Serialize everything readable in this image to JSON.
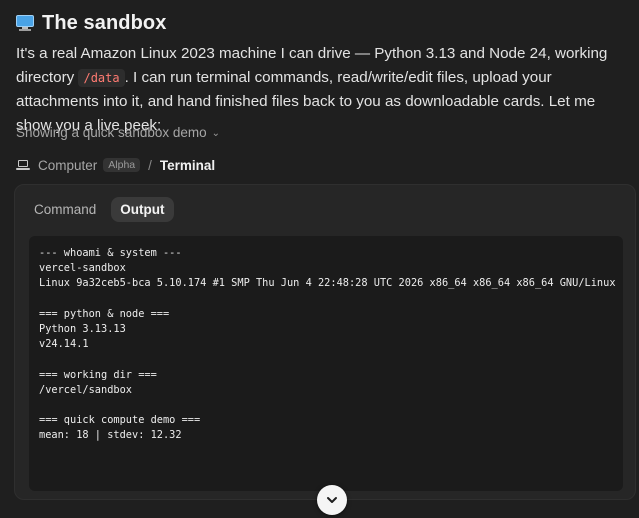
{
  "heading": {
    "icon": "desktop-computer-icon",
    "title": "The sandbox"
  },
  "intro": {
    "part1": "It's a real Amazon Linux 2023 machine I can drive — Python 3.13 and Node 24, working directory ",
    "code": "/data",
    "part2": ". I can run terminal commands, read/write/edit files, upload your attachments into it, and hand finished files back to you as downloadable cards. Let me show you a live peek:"
  },
  "demo_toggle": {
    "label": "Showing a quick sandbox demo",
    "icon": "chevron-down-icon"
  },
  "breadcrumb": {
    "icon": "laptop-icon",
    "root": "Computer",
    "badge": "Alpha",
    "separator": "/",
    "current": "Terminal"
  },
  "tabs": [
    {
      "label": "Command",
      "active": false
    },
    {
      "label": "Output",
      "active": true
    }
  ],
  "terminal_lines": [
    "--- whoami & system ---",
    "vercel-sandbox",
    "Linux 9a32ceb5-bca 5.10.174 #1 SMP Thu Jun 4 22:48:28 UTC 2026 x86_64 x86_64 x86_64 GNU/Linux",
    "",
    "=== python & node ===",
    "Python 3.13.13",
    "v24.14.1",
    "",
    "=== working dir ===",
    "/vercel/sandbox",
    "",
    "=== quick compute demo ===",
    "mean: 18 | stdev: 12.32"
  ],
  "scroll_button": {
    "icon": "chevron-down-icon"
  },
  "colors": {
    "background": "#1f1f1f",
    "panel": "#262626",
    "terminal": "#1b1b1b",
    "code_text": "#ff7b72"
  }
}
